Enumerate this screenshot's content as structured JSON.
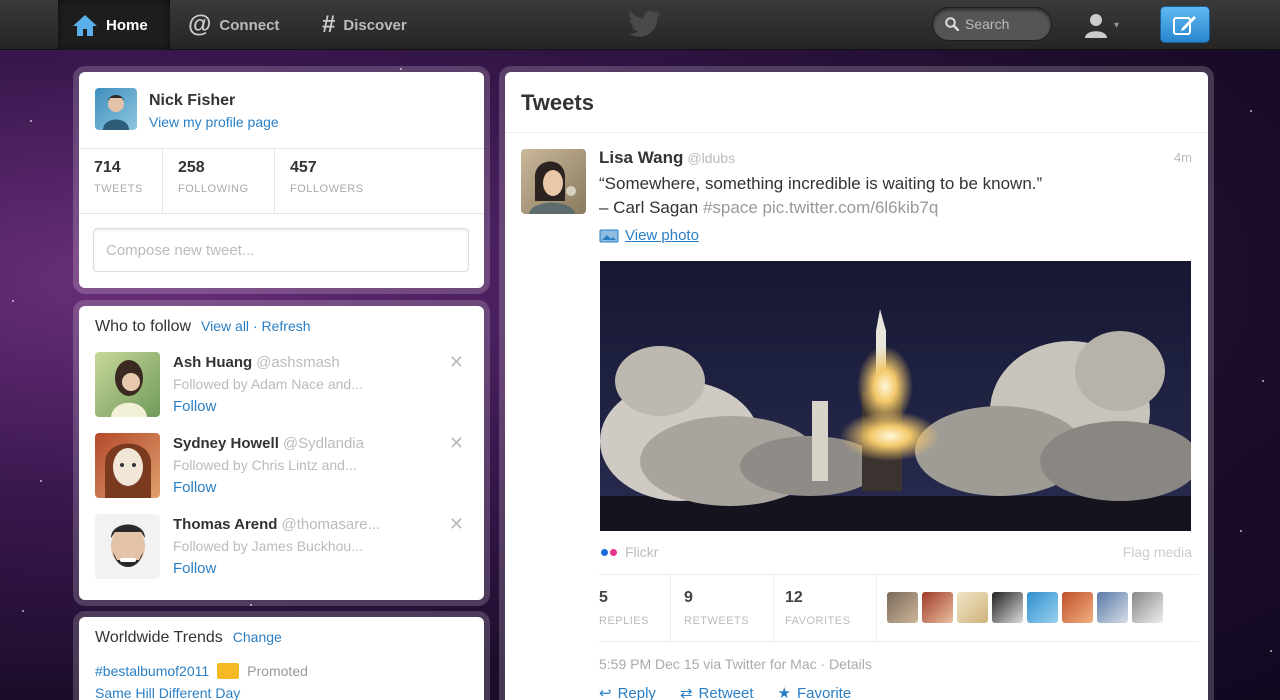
{
  "nav": {
    "home": "Home",
    "connect": "Connect",
    "discover": "Discover",
    "search_placeholder": "Search"
  },
  "profile": {
    "name": "Nick Fisher",
    "link": "View my profile page",
    "stats": [
      {
        "value": "714",
        "label": "TWEETS"
      },
      {
        "value": "258",
        "label": "FOLLOWING"
      },
      {
        "value": "457",
        "label": "FOLLOWERS"
      }
    ],
    "compose_placeholder": "Compose new tweet..."
  },
  "who_to_follow": {
    "title": "Who to follow",
    "view_all": "View all",
    "sep": "·",
    "refresh": "Refresh",
    "users": [
      {
        "name": "Ash Huang",
        "handle": "@ashsmash",
        "context": "Followed by Adam Nace and...",
        "action": "Follow"
      },
      {
        "name": "Sydney Howell",
        "handle": "@Sydlandia",
        "context": "Followed by Chris Lintz and...",
        "action": "Follow"
      },
      {
        "name": "Thomas Arend",
        "handle": "@thomasare...",
        "context": "Followed by James Buckhou...",
        "action": "Follow"
      }
    ],
    "dismiss": "✕"
  },
  "trends": {
    "title": "Worldwide Trends",
    "change": "Change",
    "items": [
      {
        "text": "#bestalbumof2011",
        "promoted": "Promoted"
      },
      {
        "text": "Same Hill Different Day"
      }
    ]
  },
  "tweets": {
    "title": "Tweets",
    "tweet": {
      "author": "Lisa Wang",
      "handle": "@ldubs",
      "time": "4m",
      "line1": "“Somewhere, something incredible is waiting to be known.”",
      "line2_prefix": "– Carl Sagan",
      "hashtag": "#space",
      "pic_link": "pic.twitter.com/6l6kib7q",
      "view_photo": "View photo",
      "source": "Flickr",
      "flag": "Flag media",
      "stats": [
        {
          "value": "5",
          "label": "REPLIES"
        },
        {
          "value": "9",
          "label": "RETWEETS"
        },
        {
          "value": "12",
          "label": "FAVORITES"
        }
      ],
      "meta": "5:59 PM Dec 15 via Twitter for Mac · Details",
      "actions": {
        "reply": "Reply",
        "retweet": "Retweet",
        "favorite": "Favorite"
      }
    }
  },
  "colors": {
    "accent": "#2a7fc4",
    "topbar": "#2e2e2e",
    "compose_button": "#3b9ae0"
  }
}
